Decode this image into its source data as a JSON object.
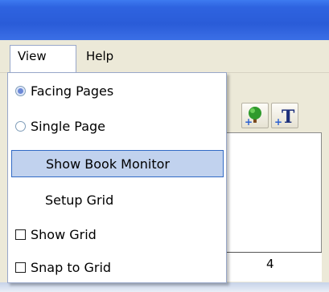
{
  "menubar": {
    "items": [
      {
        "label": "View"
      },
      {
        "label": "Help"
      }
    ]
  },
  "view_menu": {
    "items": [
      {
        "label": "Facing Pages",
        "type": "radio",
        "selected": true
      },
      {
        "label": "Single Page",
        "type": "radio",
        "selected": false
      },
      {
        "label": "Show Book Monitor",
        "type": "command",
        "highlighted": true
      },
      {
        "label": "Setup Grid",
        "type": "command"
      },
      {
        "label": "Show Grid",
        "type": "checkbox",
        "checked": false
      },
      {
        "label": "Snap to Grid",
        "type": "checkbox",
        "checked": false
      }
    ]
  },
  "toolbar": {
    "icons": [
      "add-tree-icon",
      "add-text-icon"
    ]
  },
  "page": {
    "number": "4"
  },
  "colors": {
    "titlebar": "#2a5cd8",
    "menu_highlight": "#c1d2ee",
    "menu_highlight_border": "#316ac5"
  }
}
